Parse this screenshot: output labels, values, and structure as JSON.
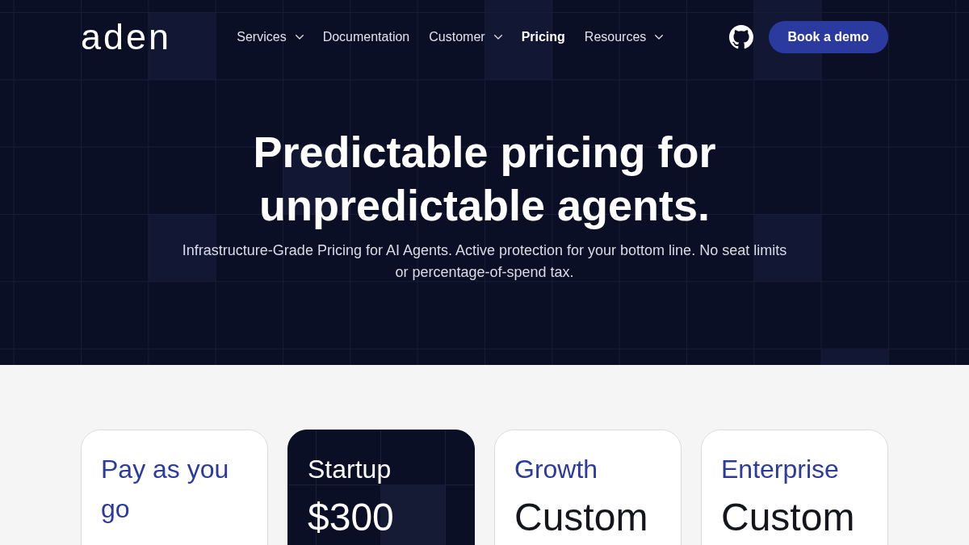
{
  "header": {
    "logo": "aden",
    "nav": [
      {
        "label": "Services",
        "dropdown": true,
        "selected": false
      },
      {
        "label": "Documentation",
        "dropdown": false,
        "selected": false
      },
      {
        "label": "Customer",
        "dropdown": true,
        "selected": false
      },
      {
        "label": "Pricing",
        "dropdown": false,
        "selected": true
      },
      {
        "label": "Resources",
        "dropdown": true,
        "selected": false
      }
    ],
    "button": "Book a demo"
  },
  "hero": {
    "title": "Predictable pricing for unpredictable agents.",
    "subtitle": "Infrastructure-Grade Pricing for AI Agents. Active protection for your bottom line. No seat limits or percentage-of-spend tax."
  },
  "plans": [
    {
      "name": "Pay as you go",
      "featured": false
    },
    {
      "name": "Startup",
      "featured": true,
      "price": "$300"
    },
    {
      "name": "Growth",
      "featured": false,
      "price": "Custom"
    },
    {
      "name": "Enterprise",
      "featured": false,
      "price": "Custom"
    }
  ]
}
